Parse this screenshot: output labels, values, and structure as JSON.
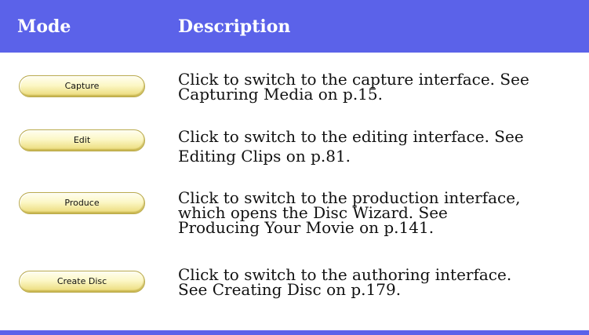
{
  "header": {
    "mode_label": "Mode",
    "description_label": "Description"
  },
  "rows": [
    {
      "button_label": "Capture",
      "description_lines": [
        "Click to switch to the capture interface. See",
        "Capturing Media on p.15."
      ]
    },
    {
      "button_label": "Edit",
      "description_lines": [
        "Click to switch to the editing interface. See",
        "Editing Clips on p.81."
      ]
    },
    {
      "button_label": "Produce",
      "description_lines": [
        "Click to switch to the production interface,",
        "which opens the Disc Wizard. See",
        "Producing Your Movie on p.141."
      ]
    },
    {
      "button_label": "Create Disc",
      "description_lines": [
        "Click to switch to the authoring interface.",
        "See Creating Disc on p.179."
      ]
    }
  ],
  "colors": {
    "header_background": "#5b62e9",
    "header_text": "#ffffff",
    "button_fill": "#fcf7c6"
  }
}
